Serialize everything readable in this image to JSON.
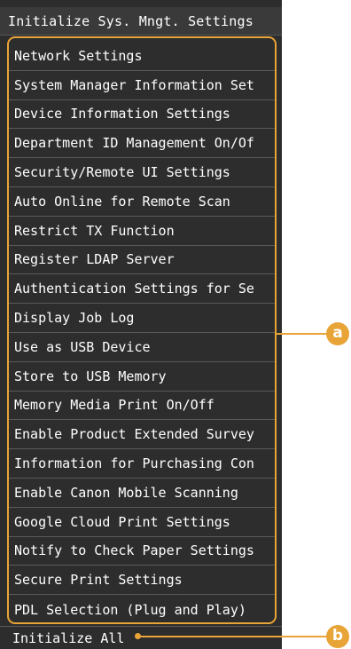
{
  "screen": {
    "title": "Initialize Sys. Mngt. Settings"
  },
  "menu": {
    "items": [
      {
        "label": "Network Settings"
      },
      {
        "label": "System Manager Information Set"
      },
      {
        "label": "Device Information Settings"
      },
      {
        "label": "Department ID Management On/Of"
      },
      {
        "label": "Security/Remote UI Settings"
      },
      {
        "label": "Auto Online for Remote Scan"
      },
      {
        "label": "Restrict TX Function"
      },
      {
        "label": "Register LDAP Server"
      },
      {
        "label": "Authentication Settings for Se"
      },
      {
        "label": "Display Job Log"
      },
      {
        "label": "Use as USB Device"
      },
      {
        "label": "Store to USB Memory"
      },
      {
        "label": "Memory Media Print On/Off"
      },
      {
        "label": "Enable Product Extended Survey"
      },
      {
        "label": "Information for Purchasing Con"
      },
      {
        "label": "Enable Canon Mobile Scanning"
      },
      {
        "label": "Google Cloud Print Settings"
      },
      {
        "label": "Notify to Check Paper Settings"
      },
      {
        "label": "Secure Print Settings"
      },
      {
        "label": "PDL Selection (Plug and Play)"
      }
    ]
  },
  "bottom": {
    "label": "Initialize All"
  },
  "callouts": {
    "a": "a",
    "b": "b"
  },
  "colors": {
    "accent": "#e8a436",
    "screen_bg": "#2d2d2d",
    "text": "#ffffff"
  }
}
